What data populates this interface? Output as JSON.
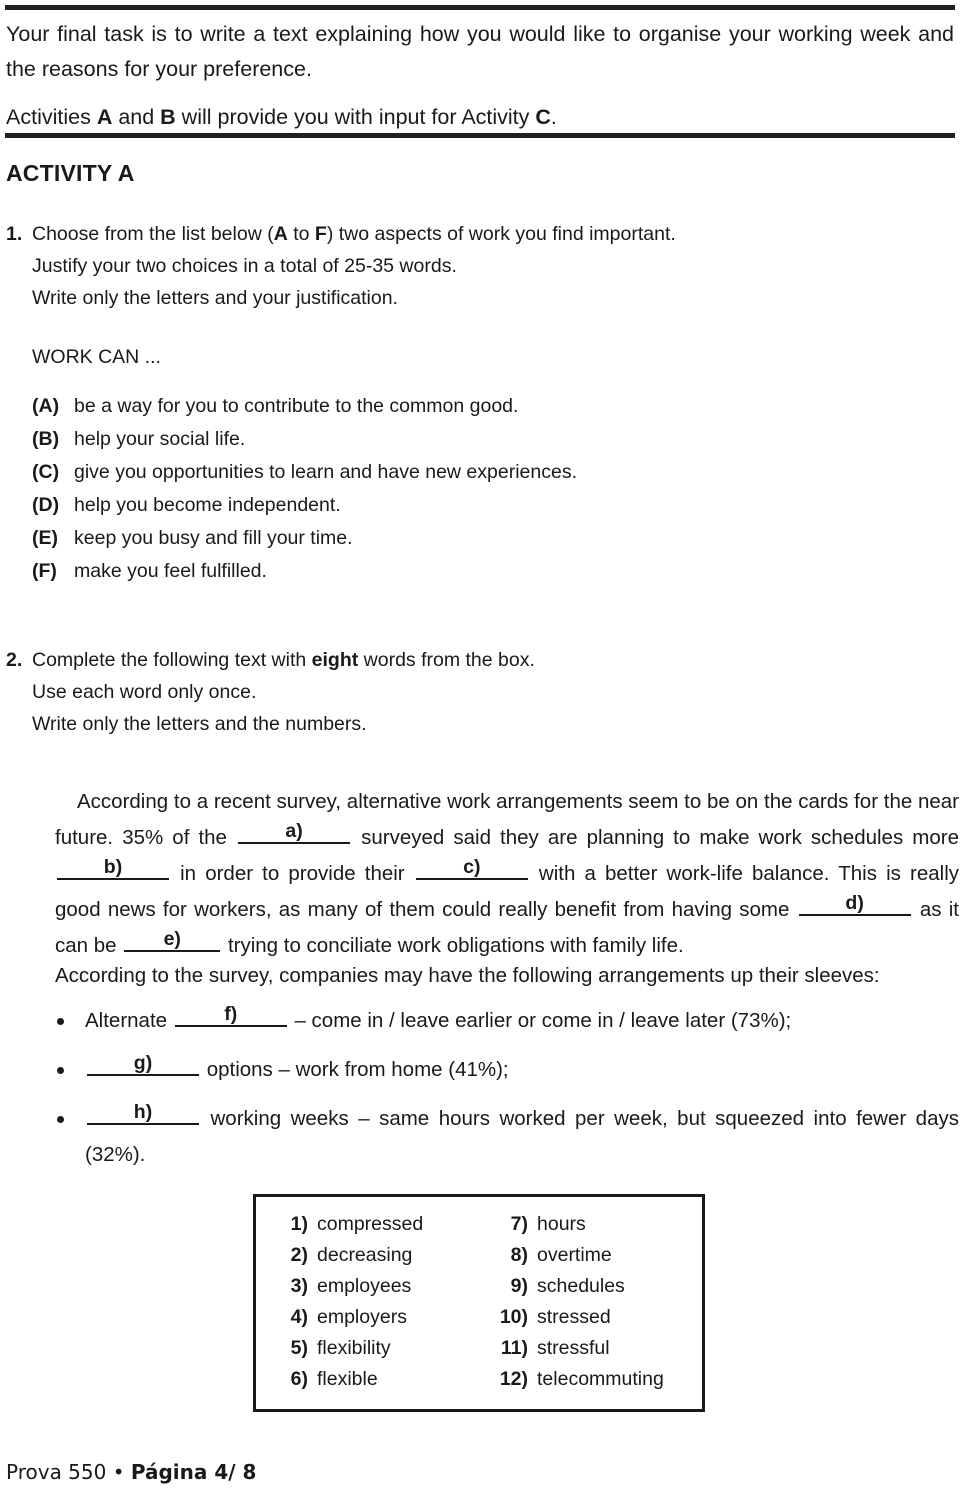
{
  "document": {
    "intro": {
      "paragraph_1_part1": "Your final task is to write a text explaining how you would like to organise your working week and the reasons for your preference.",
      "paragraph_2_part1": "Activities ",
      "paragraph_2_bold1": "A",
      "paragraph_2_part2": " and ",
      "paragraph_2_bold2": "B",
      "paragraph_2_part3": " will provide you with input for Activity ",
      "paragraph_2_bold3": "C",
      "paragraph_2_part4": "."
    },
    "activity_heading": "ACTIVITY A",
    "question_1": {
      "number": "1.",
      "line1_part1": "Choose from the list below (",
      "line1_bold1": "A",
      "line1_part2": " to ",
      "line1_bold2": "F",
      "line1_part3": ") two aspects of work you find important.",
      "line2": "Justify your two choices in a total of 25-35 words.",
      "line3": "Write only the letters and your justification."
    },
    "work_can_title": "WORK CAN ...",
    "choices": [
      {
        "label": "(A)",
        "text": "be a way for you to contribute to the common good."
      },
      {
        "label": "(B)",
        "text": "help your social life."
      },
      {
        "label": "(C)",
        "text": "give you opportunities to learn and have new experiences."
      },
      {
        "label": "(D)",
        "text": "help you become independent."
      },
      {
        "label": "(E)",
        "text": "keep you busy and fill your time."
      },
      {
        "label": "(F)",
        "text": "make you feel fulfilled."
      }
    ],
    "question_2": {
      "number": "2.",
      "line1_part1": "Complete the following text with ",
      "line1_bold1": "eight",
      "line1_part2": " words from the box.",
      "line2": "Use each word only once.",
      "line3": "Write only the letters and the numbers."
    },
    "cloze_text": {
      "seg_1": "According to a recent survey, alternative work arrangements seem to be on the cards for the near future. 35% of the ",
      "blank_a": "a)",
      "seg_2": " surveyed said they are planning to make work schedules more ",
      "blank_b": "b)",
      "seg_3": " in order to provide their ",
      "blank_c": "c)",
      "seg_4": " with a better work-life balance. This is really good news for workers, as many of them could really benefit from having some ",
      "blank_d": "d)",
      "seg_5": " as it can be ",
      "blank_e": "e)",
      "seg_6": " trying to conciliate work obligations with family life."
    },
    "cloze_text_2": "According to the survey, companies may have the following arrangements up their sleeves:",
    "bullets": [
      {
        "before": "Alternate ",
        "blank": "f)",
        "after": " – come in / leave earlier or come in / leave later (73%);"
      },
      {
        "before": "",
        "blank": "g)",
        "after": " options – work from home (41%);"
      },
      {
        "before": "",
        "blank": "h)",
        "after": " working weeks – same hours worked per week, but squeezed into fewer days (32%)."
      }
    ],
    "word_box": {
      "column_1": [
        {
          "number": "1)",
          "word": "compressed"
        },
        {
          "number": "2)",
          "word": "decreasing"
        },
        {
          "number": "3)",
          "word": "employees"
        },
        {
          "number": "4)",
          "word": "employers"
        },
        {
          "number": "5)",
          "word": "flexibility"
        },
        {
          "number": "6)",
          "word": "flexible"
        }
      ],
      "column_2": [
        {
          "number": "7)",
          "word": "hours"
        },
        {
          "number": "8)",
          "word": "overtime"
        },
        {
          "number": "9)",
          "word": "schedules"
        },
        {
          "number": "10)",
          "word": "stressed"
        },
        {
          "number": "11)",
          "word": "stressful"
        },
        {
          "number": "12)",
          "word": "telecommuting"
        }
      ]
    },
    "footer": {
      "prefix": "Prova 550 • ",
      "page": "Página 4/ 8"
    },
    "colors": {
      "text": "#1a1a1a",
      "rule": "#221f1f",
      "background": "#ffffff"
    }
  }
}
